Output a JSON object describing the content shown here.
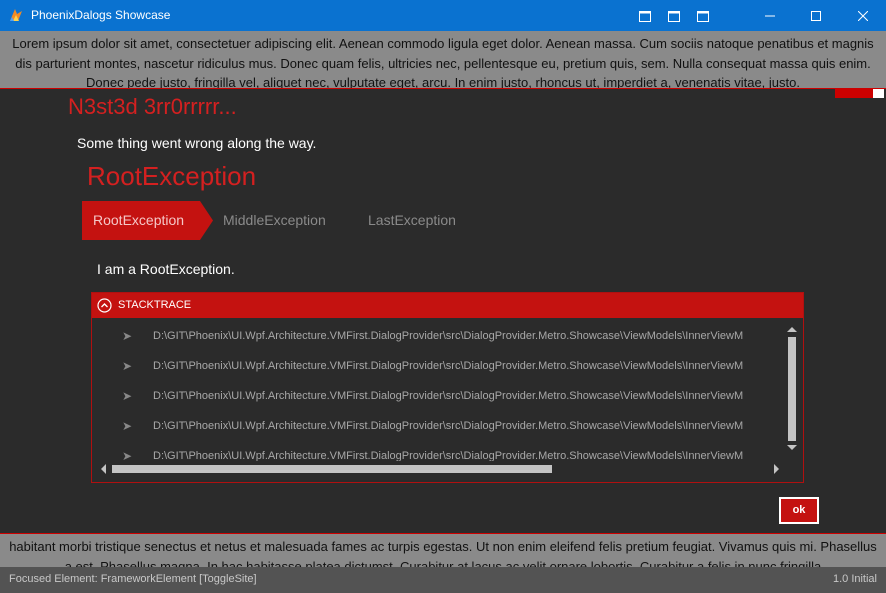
{
  "window": {
    "title": "PhoenixDalogs Showcase",
    "icons": [
      "app-logo-icon",
      "layout-icon-1",
      "layout-icon-2",
      "layout-icon-3",
      "minimize-icon",
      "maximize-icon",
      "close-icon"
    ]
  },
  "lorem_top": "Lorem ipsum dolor sit amet, consectetuer adipiscing elit. Aenean commodo ligula eget dolor. Aenean massa. Cum sociis natoque penatibus et magnis dis parturient montes, nascetur ridiculus mus. Donec quam felis, ultricies nec, pellentesque eu, pretium quis, sem. Nulla consequat massa quis enim. Donec pede justo, fringilla vel, aliquet nec, vulputate eget, arcu. In enim justo, rhoncus ut, imperdiet a, venenatis vitae, justo.",
  "dialog": {
    "title": "N3st3d 3rr0rrrrr...",
    "message": "Some thing went wrong along the way.",
    "exception_title": "RootException",
    "breadcrumbs": [
      "RootException",
      "MiddleException",
      "LastException"
    ],
    "active_breadcrumb": "RootException",
    "exception_message": "I am a RootException.",
    "stacktrace": {
      "label": "STACKTRACE",
      "expanded": true,
      "rows": [
        "D:\\GIT\\Phoenix\\UI.Wpf.Architecture.VMFirst.DialogProvider\\src\\DialogProvider.Metro.Showcase\\ViewModels\\InnerViewM",
        "D:\\GIT\\Phoenix\\UI.Wpf.Architecture.VMFirst.DialogProvider\\src\\DialogProvider.Metro.Showcase\\ViewModels\\InnerViewM",
        "D:\\GIT\\Phoenix\\UI.Wpf.Architecture.VMFirst.DialogProvider\\src\\DialogProvider.Metro.Showcase\\ViewModels\\InnerViewM",
        "D:\\GIT\\Phoenix\\UI.Wpf.Architecture.VMFirst.DialogProvider\\src\\DialogProvider.Metro.Showcase\\ViewModels\\InnerViewM",
        "D:\\GIT\\Phoenix\\UI.Wpf.Architecture.VMFirst.DialogProvider\\src\\DialogProvider.Metro.Showcase\\ViewModels\\InnerViewM"
      ]
    },
    "ok_label": "ok"
  },
  "lorem_bottom": "habitant morbi tristique senectus et netus et malesuada fames ac turpis egestas. Ut non enim eleifend felis pretium feugiat. Vivamus quis mi. Phasellus a est. Phasellus magna. In hac habitasse platea dictumst. Curabitur at lacus ac velit ornare lobortis. Curabitur a felis in nunc fringilla",
  "status": {
    "focused": "Focused Element: FrameworkElement [ToggleSite]",
    "version": "1.0 Initial"
  },
  "colors": {
    "accent": "#c41210",
    "titlebar": "#0a72d0",
    "dialog_bg": "#2b2b2b"
  }
}
